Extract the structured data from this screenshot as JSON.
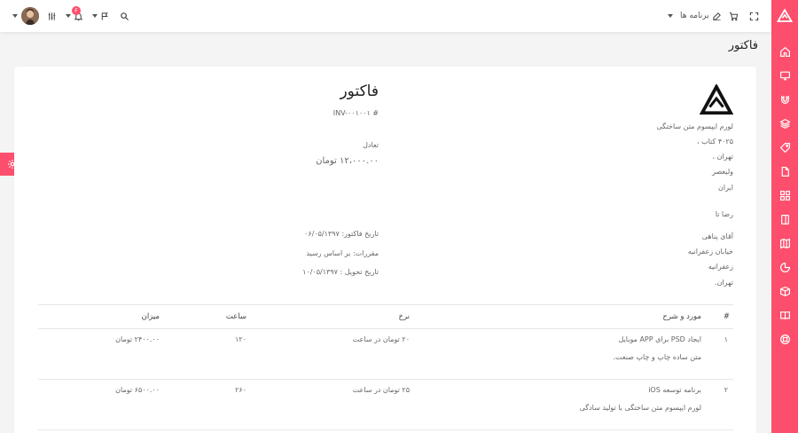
{
  "colors": {
    "accent": "#fd4f6d",
    "sidebar_bg": "#fd4f6d",
    "topbar_bg": "#ffffff",
    "page_bg": "#f4f4f4"
  },
  "sidebar": {
    "items": [
      {
        "name": "home"
      },
      {
        "name": "monitor"
      },
      {
        "name": "magnet"
      },
      {
        "name": "layers"
      },
      {
        "name": "tag"
      },
      {
        "name": "file"
      },
      {
        "name": "grid"
      },
      {
        "name": "sidebar-panel"
      },
      {
        "name": "map"
      },
      {
        "name": "pie"
      },
      {
        "name": "package"
      },
      {
        "name": "book"
      },
      {
        "name": "lifebuoy"
      }
    ]
  },
  "topbar": {
    "programs_label": "برنامه ها",
    "notification_count": "F"
  },
  "page": {
    "title": "فاکتور"
  },
  "invoice": {
    "title": "فاکتور",
    "number": "# INV-۰۰۱۰۰۱",
    "balance_label": "تعادل",
    "balance_value": "۱۲،۰۰۰.۰۰ تومان",
    "date": "تاریخ فاکتور: ۰۶/۰۵/۱۳۹۷",
    "terms": "مقررات: بر اساس رسید",
    "due_date": "تاریخ تحویل : ۱۰/۰۵/۱۳۹۷"
  },
  "company": {
    "name": "لورم ایپسوم متن ساختگی",
    "line1": "۴۰۲۵ کتاب ،",
    "line2": "تهران ،",
    "line3": "ولیعصر",
    "line4": "ایران"
  },
  "bill_to": {
    "label": "رضا تا",
    "name": "آقای پناهی",
    "street": "خیابان زعفرانیه",
    "area": "زعفرانیه",
    "city": "تهران."
  },
  "table": {
    "headers": {
      "num": "#",
      "desc": "مورد و شرح",
      "rate": "نرخ",
      "hours": "ساعت",
      "amount": "میزان"
    },
    "rows": [
      {
        "num": "۱",
        "title": "ایجاد PSD برای APP موبایل",
        "sub": "متن ساده چاپ و چاپ صنعت.",
        "rate": "۲۰ تومان در ساعت",
        "hours": "۱۲۰",
        "amount": "۲۴۰۰.۰۰ تومان"
      },
      {
        "num": "۲",
        "title": "برنامه توسعه iOS",
        "sub": "لورم ایپسوم متن ساختگی با تولید سادگی",
        "rate": "۲۵ تومان در ساعت",
        "hours": "۲۶۰",
        "amount": "۶۵۰۰.۰۰ تومان"
      }
    ]
  }
}
